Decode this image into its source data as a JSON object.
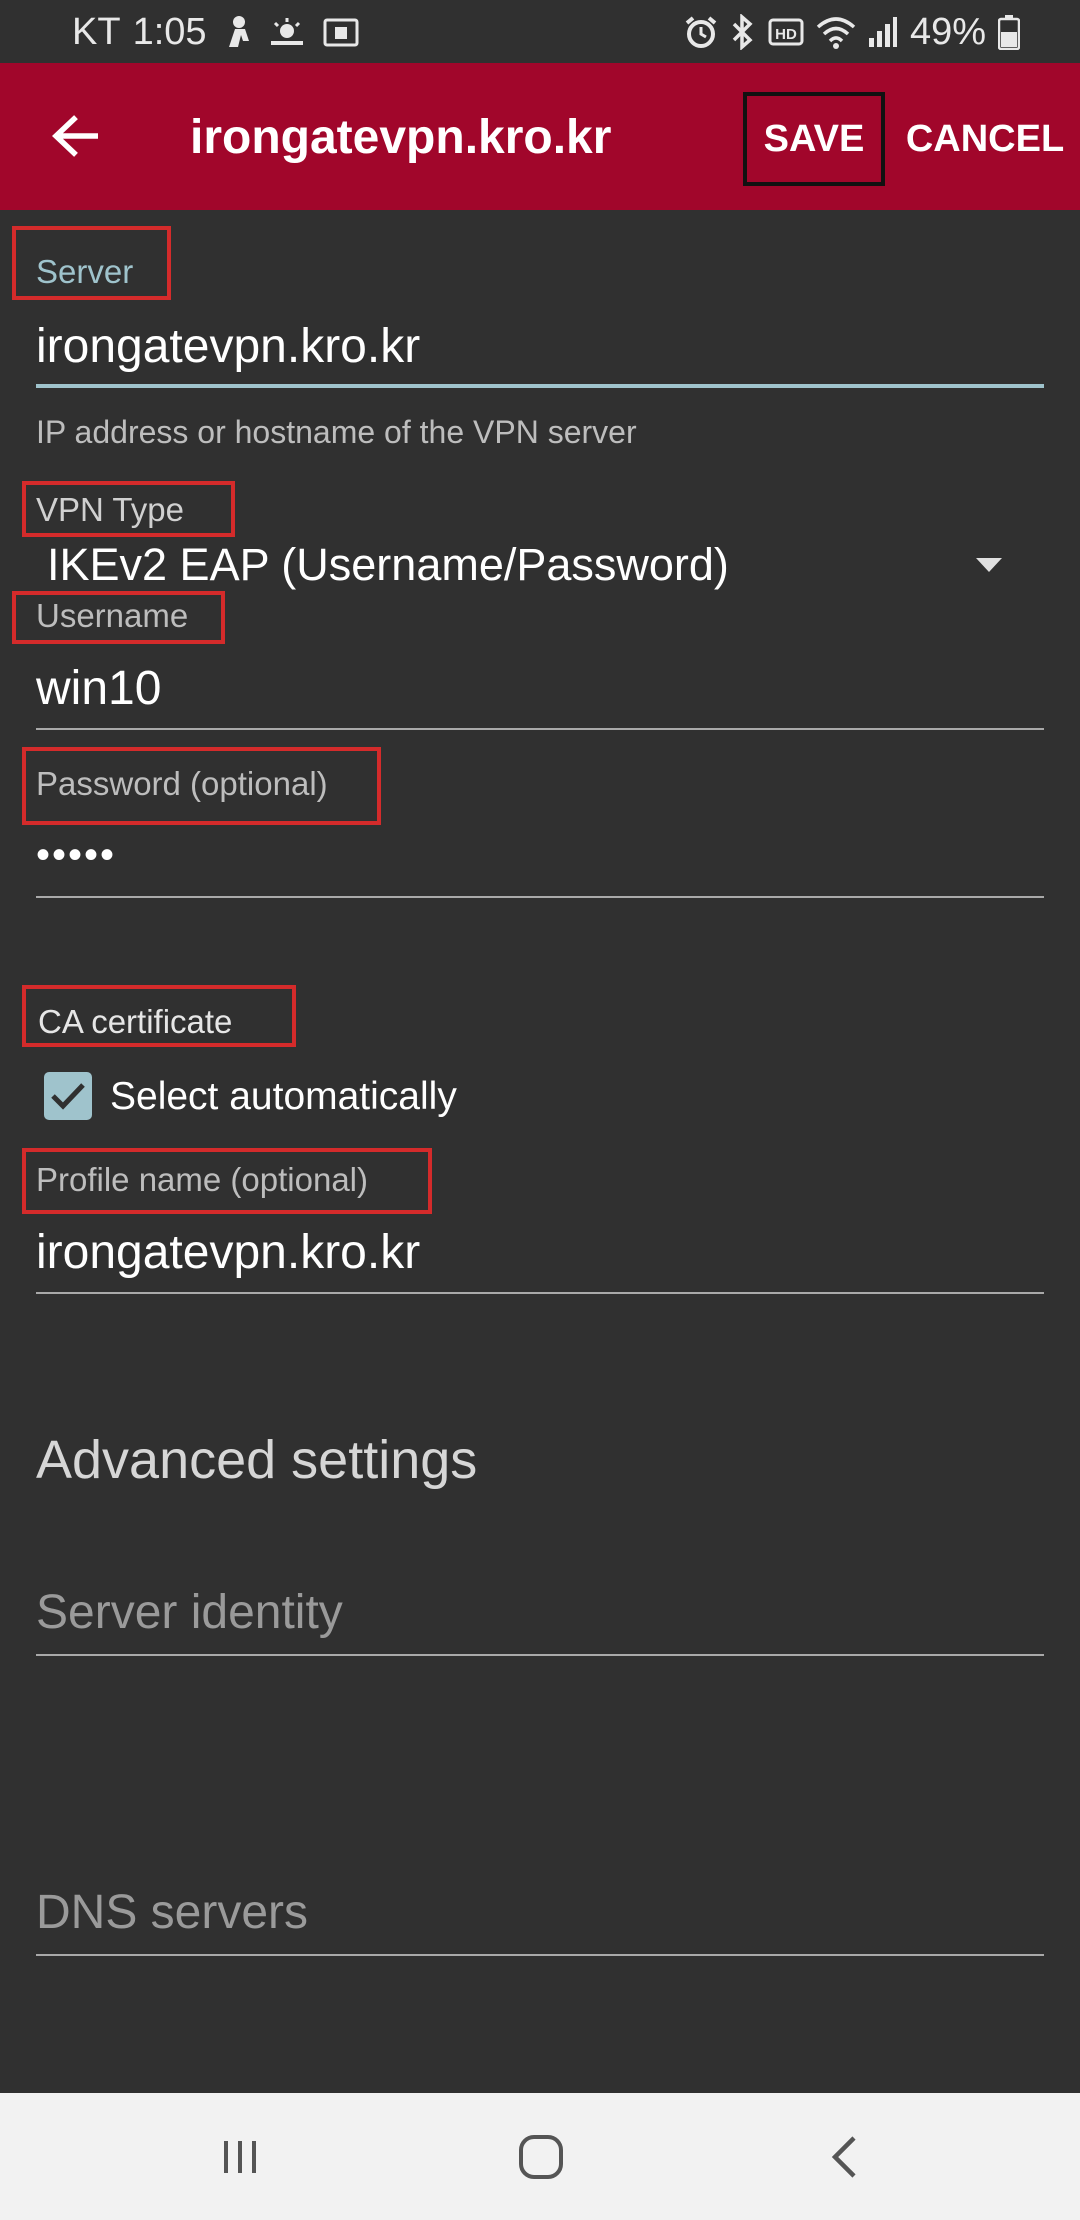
{
  "status_bar": {
    "carrier": "KT",
    "time": "1:05",
    "battery": "49%"
  },
  "app_bar": {
    "title": "irongatevpn.kro.kr",
    "save_label": "SAVE",
    "cancel_label": "CANCEL"
  },
  "form": {
    "server": {
      "label": "Server",
      "value": "irongatevpn.kro.kr",
      "helper": "IP address or hostname of the VPN server"
    },
    "vpn_type": {
      "label": "VPN Type",
      "value": "IKEv2 EAP (Username/Password)"
    },
    "username": {
      "label": "Username",
      "value": "win10"
    },
    "password": {
      "label": "Password (optional)",
      "value": "•••••"
    },
    "ca_certificate": {
      "label": "CA certificate",
      "checkbox_label": "Select automatically",
      "checked": true
    },
    "profile_name": {
      "label": "Profile name (optional)",
      "value": "irongatevpn.kro.kr"
    }
  },
  "advanced": {
    "title": "Advanced settings",
    "server_identity_placeholder": "Server identity",
    "dns_servers_placeholder": "DNS servers"
  },
  "icons": {
    "back": "arrow-left-icon",
    "dropdown": "triangle-down-icon",
    "check": "check-icon",
    "nav_recent": "recent-apps-icon",
    "nav_home": "home-icon",
    "nav_back": "chevron-left-icon"
  },
  "colors": {
    "app_bar": "#a1062b",
    "background": "#303030",
    "accent": "#9fc3cc",
    "annotation_box": "#d42b2b"
  }
}
